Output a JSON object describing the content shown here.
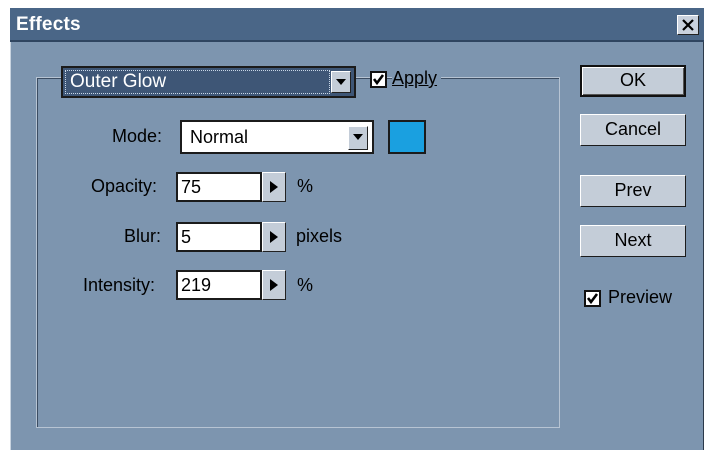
{
  "window": {
    "title": "Effects",
    "close_label": "X"
  },
  "effect": {
    "selected": "Outer Glow",
    "apply_label": "Apply",
    "apply_checked": true
  },
  "fields": {
    "mode": {
      "label": "Mode:",
      "value": "Normal"
    },
    "opacity": {
      "label": "Opacity:",
      "value": "75",
      "unit": "%"
    },
    "blur": {
      "label": "Blur:",
      "value": "5",
      "unit": "pixels"
    },
    "intensity": {
      "label": "Intensity:",
      "value": "219",
      "unit": "%"
    }
  },
  "glow_color": "#1aa0e0",
  "buttons": {
    "ok": "OK",
    "cancel": "Cancel",
    "prev": "Prev",
    "next": "Next"
  },
  "preview": {
    "label": "Preview",
    "checked": true
  }
}
